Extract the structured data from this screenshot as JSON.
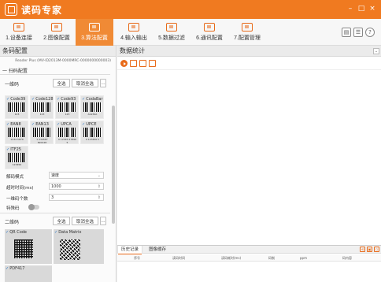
{
  "app": {
    "title": "读码专家",
    "window_controls": [
      "–",
      "□",
      "×"
    ]
  },
  "toolbar": {
    "items": [
      {
        "label": "1.设备连接",
        "icon": "camera-icon"
      },
      {
        "label": "2.图像配置",
        "icon": "image-icon"
      },
      {
        "label": "3.算法配置",
        "icon": "algorithm-icon"
      },
      {
        "label": "4.输入输出",
        "icon": "io-icon"
      },
      {
        "label": "5.数据过滤",
        "icon": "filter-icon"
      },
      {
        "label": "6.通讯配置",
        "icon": "network-icon"
      },
      {
        "label": "7.配置管理",
        "icon": "config-icon"
      }
    ],
    "active_index": 2,
    "right_icons": [
      "layout-icon",
      "menu-icon",
      "help-icon"
    ]
  },
  "left": {
    "header": "条码配置",
    "reader_info": "Reader Plus (MV-ID2013M-0000MRC-0000000000003)",
    "section1": {
      "title": "一 扫码配置",
      "subtitle": "一维码",
      "select_all": "全选",
      "deselect_all": "取消全选",
      "codes": [
        {
          "name": "Code39",
          "num": "123"
        },
        {
          "name": "Code128",
          "num": "123"
        },
        {
          "name": "Code93",
          "num": "123"
        },
        {
          "name": "CodaBar",
          "num": "A1234A"
        },
        {
          "name": "EAN8",
          "num": "1234 5670"
        },
        {
          "name": "EAN13",
          "num": "1 234567 890128"
        },
        {
          "name": "UPCA",
          "num": "0 12345 67890 5"
        },
        {
          "name": "UPCE",
          "num": "0 123456 5"
        },
        {
          "name": "ITF25",
          "num": "123456"
        }
      ]
    },
    "fields": {
      "decode_mode_label": "解码模式",
      "decode_mode_value": "速度",
      "timeout_label": "超时时间(ms)",
      "timeout_value": "1000",
      "count_label": "一维码个数",
      "count_value": "3",
      "special_label": "特殊码"
    },
    "section2": {
      "title": "二维码",
      "select_all": "全选",
      "deselect_all": "取消全选",
      "codes": [
        "QR Code",
        "Data Matrix",
        "PDF417"
      ]
    }
  },
  "right": {
    "header": "数据统计",
    "tools": [
      "start-icon",
      "export-icon",
      "image-save-icon",
      "fullscreen-icon"
    ],
    "tabs": [
      "历史记录",
      "图像缓存"
    ],
    "columns": [
      "序号",
      "读码时间",
      "读码耗时(ms)",
      "码制",
      "ppm",
      "码内容"
    ]
  },
  "colors": {
    "accent": "#f07a20",
    "check": "#2a78c8"
  }
}
